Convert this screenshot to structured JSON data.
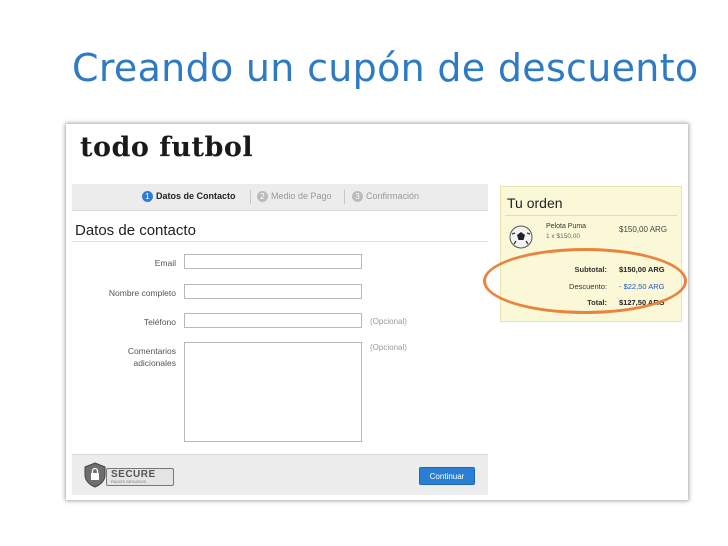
{
  "slide": {
    "title": "Creando un cupón de descuento"
  },
  "store": {
    "logo": "todo futbol"
  },
  "steps": [
    {
      "num": "1",
      "label": "Datos de Contacto"
    },
    {
      "num": "2",
      "label": "Medio de Pago"
    },
    {
      "num": "3",
      "label": "Confirmación"
    }
  ],
  "form": {
    "section_title": "Datos de contacto",
    "email_label": "Email",
    "name_label": "Nombre completo",
    "phone_label": "Teléfono",
    "phone_hint": "(Opcional)",
    "comments_label_1": "Comentarios",
    "comments_label_2": "adicionales",
    "comments_hint": "(Opcional)"
  },
  "footer": {
    "secure_badge": "SECURE",
    "secure_subtext": "PAGOS SEGUROS",
    "continue_label": "Continuar"
  },
  "order": {
    "title": "Tu orden",
    "product_name": "Pelota Puma",
    "product_qty": "1 x $150,00",
    "product_price": "$150,00 ARG",
    "subtotal_label": "Subtotal:",
    "subtotal_value": "$150,00 ARG",
    "discount_label": "Descuento:",
    "discount_value": "- $22,50 ARG",
    "total_label": "Total:",
    "total_value": "$127,50 ARG"
  },
  "colors": {
    "title_blue": "#2e7bc4",
    "accent_blue": "#2a7fd4",
    "highlight_orange": "#e8843e",
    "order_bg": "#fbf8d8"
  }
}
